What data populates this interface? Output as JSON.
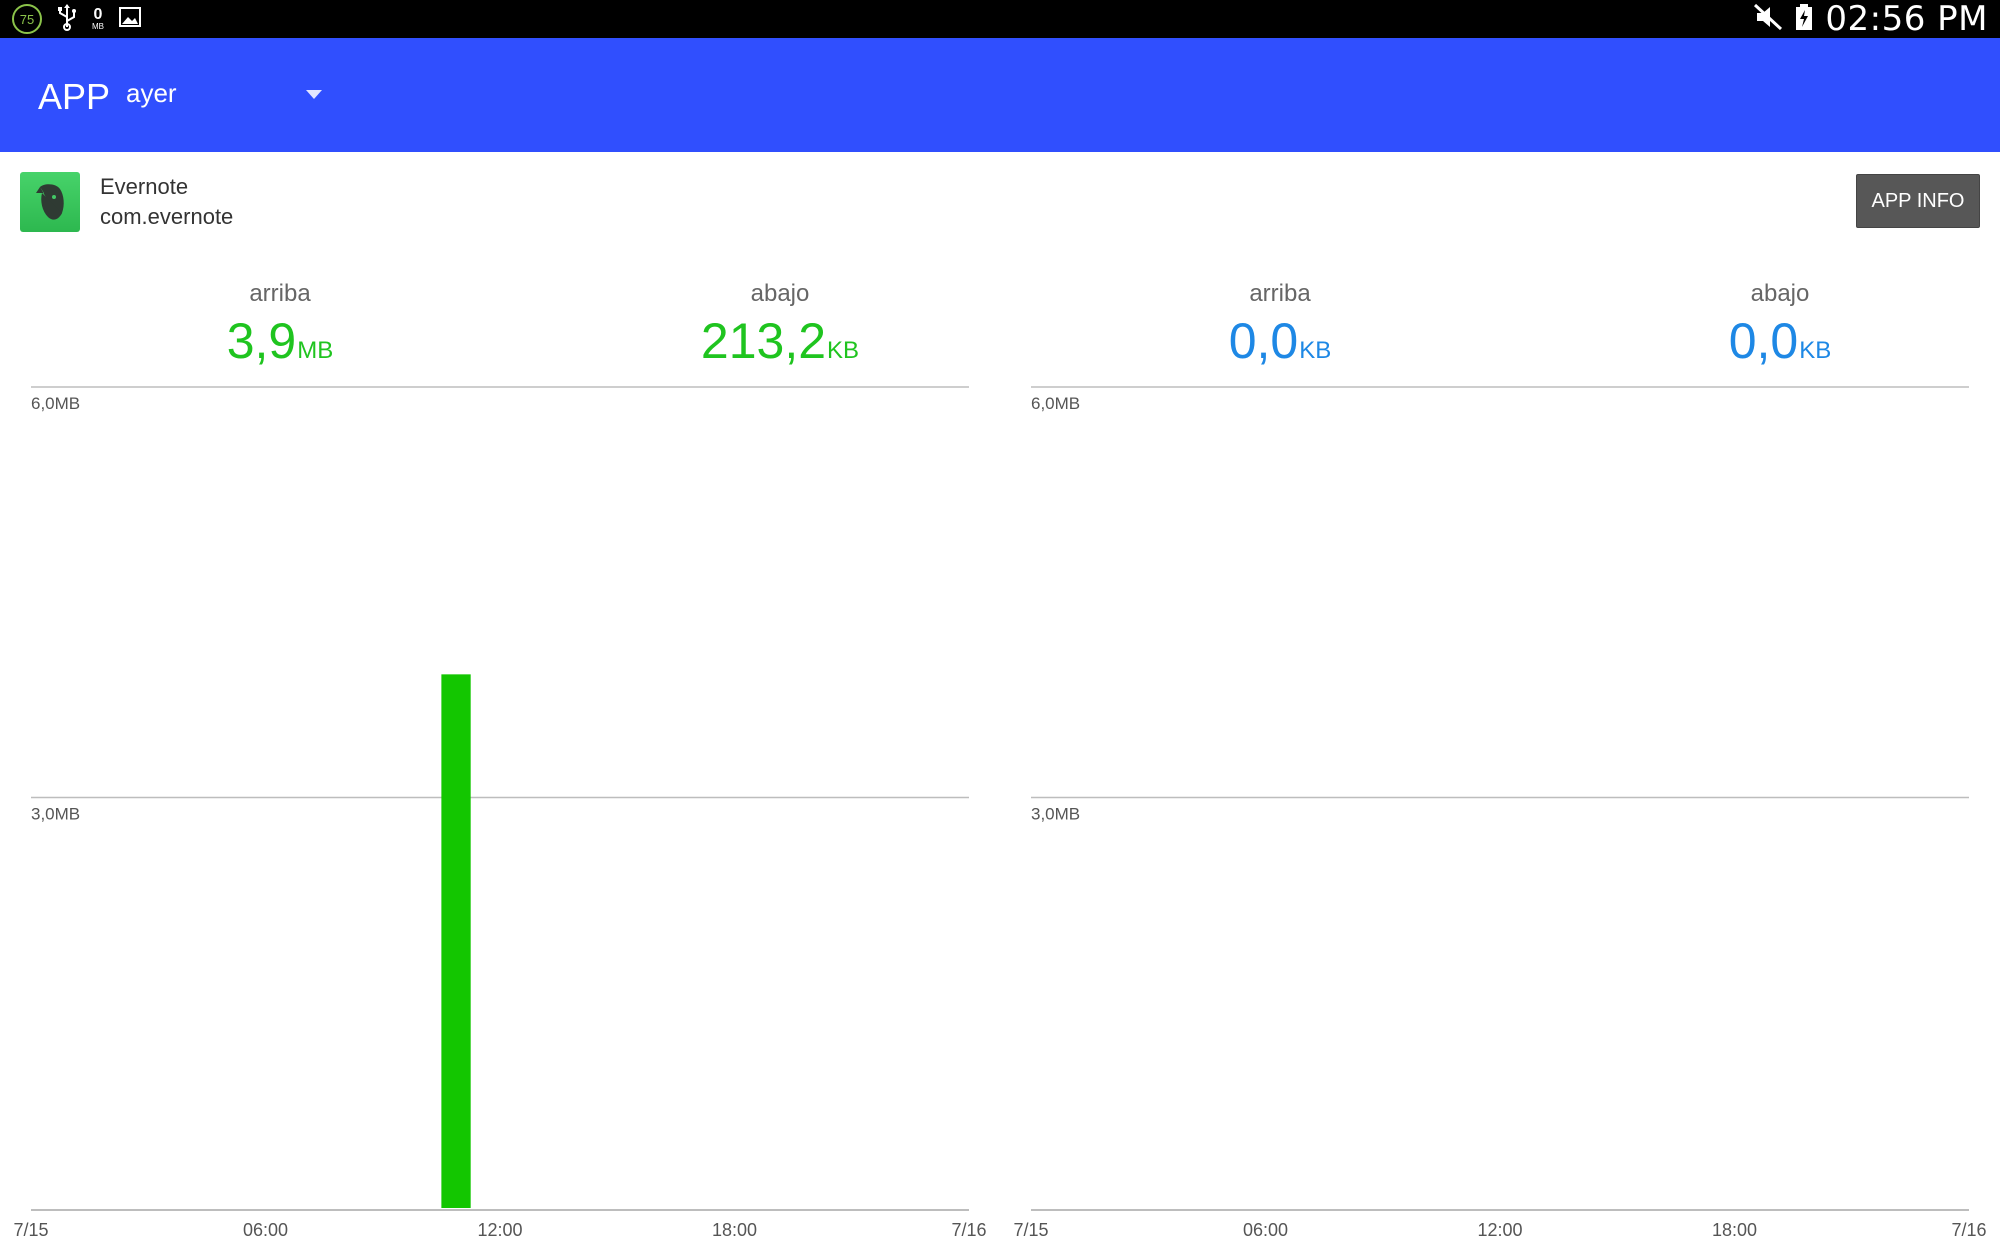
{
  "status_bar": {
    "battery_level": "75",
    "data_counter_value": "0",
    "data_counter_unit": "MB",
    "clock": "02:56 PM",
    "icons": [
      "battery-circle-icon",
      "usb-icon",
      "data-counter-icon",
      "image-notification-icon",
      "mute-icon",
      "battery-charging-icon"
    ]
  },
  "app_bar": {
    "title": "APP",
    "period": "ayer",
    "background": "#304ffe"
  },
  "app": {
    "name": "Evernote",
    "package": "com.evernote",
    "info_button": "APP INFO",
    "icon": "evernote-elephant-icon"
  },
  "panels": [
    {
      "up_label": "arriba",
      "up_value": "3,9",
      "up_unit": "MB",
      "down_label": "abajo",
      "down_value": "213,2",
      "down_unit": "KB",
      "color": "#1fc41f"
    },
    {
      "up_label": "arriba",
      "up_value": "0,0",
      "up_unit": "KB",
      "down_label": "abajo",
      "down_value": "0,0",
      "down_unit": "KB",
      "color": "#1e88e5"
    }
  ],
  "chart_data": [
    {
      "type": "bar",
      "y_ticks": [
        "6,0MB",
        "3,0MB"
      ],
      "ylim": [
        0,
        6.0
      ],
      "x_ticks": [
        "7/15",
        "06:00",
        "12:00",
        "18:00",
        "7/16"
      ],
      "x_range_hours": [
        0,
        24
      ],
      "bar_color": "#13c600",
      "bars": [
        {
          "start_hour": 10.5,
          "end_hour": 11.25,
          "value_mb": 3.9
        }
      ]
    },
    {
      "type": "bar",
      "y_ticks": [
        "6,0MB",
        "3,0MB"
      ],
      "ylim": [
        0,
        6.0
      ],
      "x_ticks": [
        "7/15",
        "06:00",
        "12:00",
        "18:00",
        "7/16"
      ],
      "x_range_hours": [
        0,
        24
      ],
      "bar_color": "#1e88e5",
      "bars": []
    }
  ]
}
